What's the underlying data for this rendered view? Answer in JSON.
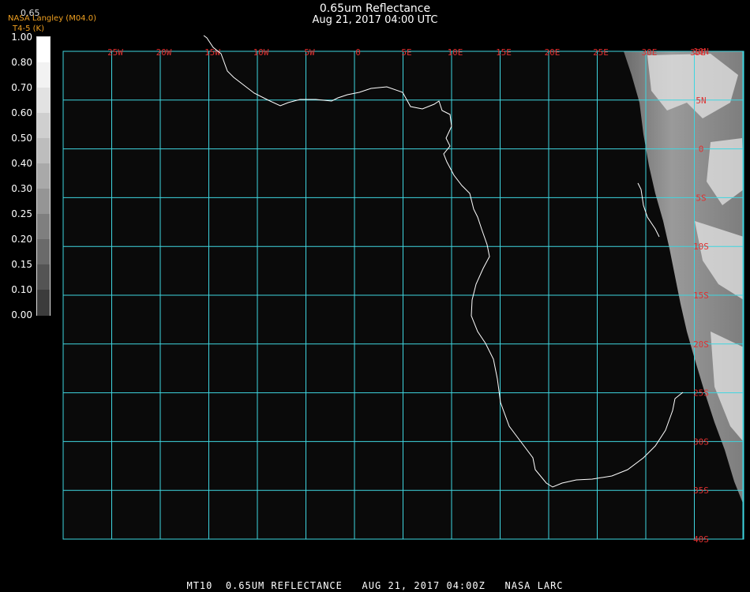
{
  "header": {
    "title": "0.65um Reflectance",
    "subtitle": "Aug 21, 2017 04:00 UTC"
  },
  "credit": {
    "line1": "NASA Langley (M04.0)",
    "line2": "T4-5 (K)",
    "channel": "0.65"
  },
  "colorbar": {
    "labels": [
      "1.00",
      "0.80",
      "0.70",
      "0.60",
      "0.50",
      "0.40",
      "0.30",
      "0.25",
      "0.20",
      "0.15",
      "0.10",
      "0.00"
    ],
    "shades": [
      "#ffffff",
      "#f2f2f2",
      "#e2e2e2",
      "#cfcfcf",
      "#bdbdbd",
      "#a9a9a9",
      "#959595",
      "#7f7f7f",
      "#6a6a6a",
      "#545454",
      "#3c3c3c"
    ]
  },
  "map": {
    "background": "#0a0a0a",
    "grid_color": "#3fd6e0",
    "label_color": "#e03030",
    "coast_color": "#ffffff",
    "lon_labels": [
      "25W",
      "20W",
      "15W",
      "10W",
      "5W",
      "0",
      "5E",
      "10E",
      "15E",
      "20E",
      "25E",
      "30E",
      "35E"
    ],
    "lat_labels": [
      "10N",
      "5N",
      "0",
      "5S",
      "10S",
      "15S",
      "20S",
      "25S",
      "30S",
      "35S",
      "40S"
    ]
  },
  "footer": {
    "text": "MT10  0.65UM REFLECTANCE   AUG 21, 2017 04:00Z   NASA LARC"
  }
}
